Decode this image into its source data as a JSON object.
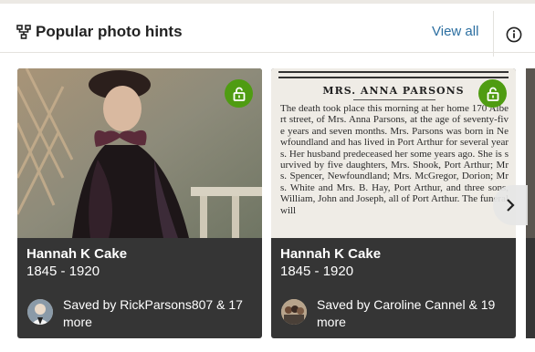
{
  "header": {
    "title": "Popular photo hints",
    "view_all_label": "View all",
    "icon": "family-tree-icon",
    "info_icon": "info-icon"
  },
  "cards": [
    {
      "name": "Hannah K Cake",
      "dates": "1845 - 1920",
      "saved_text": "Saved by RickParsons807 & 17 more",
      "photo": "portrait-photo",
      "badge_icon": "lock-open-icon"
    },
    {
      "name": "Hannah K Cake",
      "dates": "1845 - 1920",
      "saved_text": "Saved by Caroline Cannel & 19 more",
      "photo": "newspaper-clipping",
      "badge_icon": "lock-open-icon",
      "clipping": {
        "headline": "MRS. ANNA PARSONS",
        "body": "The death took place this morning at her home 170 Albert street, of Mrs. Anna Parsons, at the age of seventy-five years and seven months. Mrs. Parsons was born in Newfoundland and has lived in Port Arthur for several years. Her husband predeceased her some years ago. She is survived by five daughters, Mrs. Shook, Port Arthur; Mrs. Spencer, Newfoundland; Mrs. McGregor, Dorion; Mrs. White and Mrs. B. Hay, Port Arthur, and three sons, William, John and Joseph, all of Port Arthur. The funeral will"
      }
    }
  ],
  "carousel": {
    "next_icon": "chevron-right-icon"
  },
  "colors": {
    "accent_green": "#4f9c12",
    "link_blue": "#2c6fa1",
    "card_bg": "#353535"
  }
}
